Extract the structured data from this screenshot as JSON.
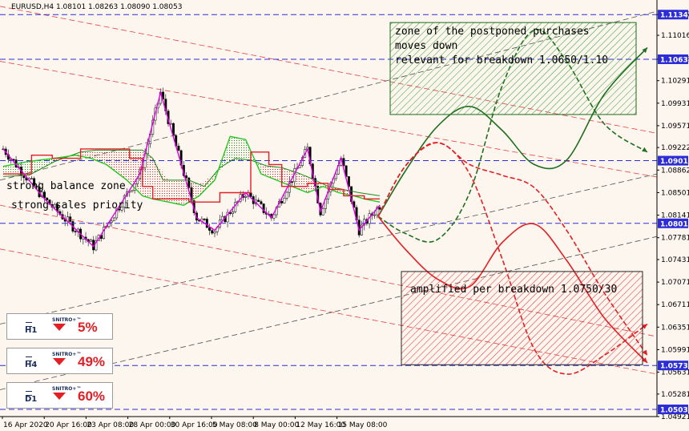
{
  "window_title": "EURUSD,H4  1.08101 1.08263 1.08090 1.08053",
  "chart_data": {
    "type": "line",
    "title": "EURUSD,H4  1.08101 1.08263 1.08090 1.08053",
    "xlabel": "",
    "ylabel": "",
    "ylim": [
      1.04921,
      1.11478
    ],
    "grid": false,
    "y_ticks": [
      "1.11347",
      "1.11016",
      "1.10633",
      "1.10291",
      "1.09931",
      "1.09571",
      "1.09222",
      "1.08862",
      "1.08501",
      "1.08141",
      "1.07781",
      "1.07431",
      "1.07071",
      "1.06711",
      "1.06351",
      "1.05991",
      "1.05631",
      "1.05281",
      "1.04921"
    ],
    "x_ticks": [
      "16 Apr 2020",
      "20 Apr 16:00",
      "23 Apr 08:00",
      "28 Apr 00:00",
      "30 Apr 16:00",
      "5 May 08:00",
      "8 May 00:00",
      "12 May 16:00",
      "15 May 08:00"
    ],
    "levels": [
      {
        "value": 1.11347,
        "label": "1.11347"
      },
      {
        "value": 1.10633,
        "label": "1.10633"
      },
      {
        "value": 1.09012,
        "label": "1.09012"
      },
      {
        "value": 1.0801,
        "label": "1.08010"
      },
      {
        "value": 1.05738,
        "label": "1.05738"
      },
      {
        "value": 1.05036,
        "label": "1.05036"
      }
    ],
    "zigzag": [
      [
        0,
        1.092
      ],
      [
        16,
        1.084
      ],
      [
        35,
        1.0764
      ],
      [
        53,
        1.088
      ],
      [
        61,
        1.101
      ],
      [
        75,
        1.081
      ],
      [
        82,
        1.079
      ],
      [
        94,
        1.085
      ],
      [
        104,
        1.081
      ],
      [
        118,
        1.092
      ],
      [
        123,
        1.082
      ],
      [
        131,
        1.0905
      ],
      [
        138,
        1.079
      ],
      [
        146,
        1.083
      ]
    ],
    "kijun": [
      [
        0,
        1.088
      ],
      [
        11,
        1.088
      ],
      [
        11,
        1.091
      ],
      [
        19,
        1.091
      ],
      [
        19,
        1.0905
      ],
      [
        30,
        1.0905
      ],
      [
        30,
        1.092
      ],
      [
        49,
        1.092
      ],
      [
        49,
        1.0905
      ],
      [
        54,
        1.0905
      ],
      [
        54,
        1.086
      ],
      [
        58,
        1.086
      ],
      [
        58,
        1.084
      ],
      [
        72,
        1.084
      ],
      [
        72,
        1.0835
      ],
      [
        84,
        1.0835
      ],
      [
        84,
        1.085
      ],
      [
        96,
        1.085
      ],
      [
        96,
        1.0915
      ],
      [
        103,
        1.0915
      ],
      [
        103,
        1.0895
      ],
      [
        108,
        1.0895
      ],
      [
        108,
        1.086
      ],
      [
        118,
        1.086
      ],
      [
        118,
        1.0865
      ],
      [
        126,
        1.0865
      ],
      [
        126,
        1.0855
      ],
      [
        132,
        1.0855
      ],
      [
        132,
        1.0845
      ],
      [
        140,
        1.0845
      ],
      [
        140,
        1.084
      ],
      [
        146,
        1.084
      ]
    ],
    "senkou_a": [
      [
        0,
        1.0892
      ],
      [
        10,
        1.09
      ],
      [
        20,
        1.0905
      ],
      [
        28,
        1.091
      ],
      [
        34,
        1.0905
      ],
      [
        40,
        1.0895
      ],
      [
        48,
        1.087
      ],
      [
        54,
        1.0845
      ],
      [
        58,
        1.084
      ],
      [
        64,
        1.0835
      ],
      [
        70,
        1.083
      ],
      [
        76,
        1.0845
      ],
      [
        82,
        1.087
      ],
      [
        88,
        1.094
      ],
      [
        94,
        1.0935
      ],
      [
        100,
        1.088
      ],
      [
        106,
        1.087
      ],
      [
        112,
        1.086
      ],
      [
        118,
        1.085
      ],
      [
        124,
        1.086
      ],
      [
        130,
        1.085
      ],
      [
        136,
        1.0845
      ],
      [
        140,
        1.084
      ],
      [
        146,
        1.0835
      ]
    ],
    "senkou_b": [
      [
        0,
        1.0876
      ],
      [
        10,
        1.0878
      ],
      [
        20,
        1.09
      ],
      [
        30,
        1.0915
      ],
      [
        36,
        1.0918
      ],
      [
        48,
        1.0918
      ],
      [
        54,
        1.0918
      ],
      [
        58,
        1.0905
      ],
      [
        62,
        1.087
      ],
      [
        72,
        1.087
      ],
      [
        78,
        1.086
      ],
      [
        84,
        1.089
      ],
      [
        90,
        1.0905
      ],
      [
        96,
        1.0902
      ],
      [
        102,
        1.0893
      ],
      [
        108,
        1.089
      ],
      [
        114,
        1.0882
      ],
      [
        120,
        1.0872
      ],
      [
        126,
        1.086
      ],
      [
        132,
        1.0855
      ],
      [
        138,
        1.085
      ],
      [
        146,
        1.0845
      ]
    ],
    "forecast_lines": [
      {
        "color": "#1f6f1f",
        "dash": false,
        "points": [
          [
            1.0812,
            0
          ],
          [
            1.0884,
            0.1
          ],
          [
            1.0956,
            0.22
          ],
          [
            1.0988,
            0.34
          ],
          [
            1.095,
            0.46
          ],
          [
            1.0895,
            0.58
          ],
          [
            1.0902,
            0.7
          ],
          [
            1.1007,
            0.84
          ],
          [
            1.1082,
            1.0
          ]
        ]
      },
      {
        "color": "#1f6f1f",
        "dash": true,
        "points": [
          [
            1.0812,
            0
          ],
          [
            1.0785,
            0.1
          ],
          [
            1.0775,
            0.22
          ],
          [
            1.085,
            0.34
          ],
          [
            1.102,
            0.46
          ],
          [
            1.111,
            0.58
          ],
          [
            1.106,
            0.7
          ],
          [
            1.096,
            0.84
          ],
          [
            1.0915,
            1.0
          ]
        ]
      },
      {
        "color": "#e31e24",
        "dash": false,
        "points": [
          [
            1.0812,
            0
          ],
          [
            1.076,
            0.1
          ],
          [
            1.0712,
            0.22
          ],
          [
            1.07,
            0.34
          ],
          [
            1.077,
            0.46
          ],
          [
            1.08,
            0.58
          ],
          [
            1.0742,
            0.7
          ],
          [
            1.065,
            0.84
          ],
          [
            1.0578,
            1.0
          ]
        ]
      },
      {
        "color": "#e31e24",
        "dash": true,
        "points": [
          [
            1.0812,
            0
          ],
          [
            1.0892,
            0.1
          ],
          [
            1.093,
            0.22
          ],
          [
            1.088,
            0.34
          ],
          [
            1.0745,
            0.46
          ],
          [
            1.06,
            0.58
          ],
          [
            1.056,
            0.7
          ],
          [
            1.059,
            0.84
          ],
          [
            1.064,
            1.0
          ]
        ]
      },
      {
        "color": "#e31e24",
        "dash": true,
        "points": [
          [
            1.0812,
            0
          ],
          [
            1.0892,
            0.1
          ],
          [
            1.093,
            0.22
          ],
          [
            1.0895,
            0.34
          ],
          [
            1.0878,
            0.46
          ],
          [
            1.0858,
            0.58
          ],
          [
            1.079,
            0.7
          ],
          [
            1.069,
            0.84
          ],
          [
            1.059,
            1.0
          ]
        ]
      }
    ],
    "zones": [
      {
        "name": "zone of the postponed purchases",
        "color": "#2a9a2a",
        "y_top": 1.1122,
        "y_bottom": 1.0975
      },
      {
        "name": "amplified per breakdown",
        "color": "#e31e24",
        "y_top": 1.0724,
        "y_bottom": 1.0575
      }
    ]
  },
  "annotations": {
    "left_1": "strong balance zone",
    "left_2": "strong sales priority",
    "green_zone_1": "zone of the postponed purchases",
    "green_zone_2": "moves down",
    "green_zone_3": "relevant for breakdown 1.0650/1.10",
    "red_zone": "amplified per breakdown 1.0750/30"
  },
  "widgets": [
    {
      "timeframe": "H1",
      "brand": "SNITRO+™",
      "value": "5%",
      "color": "#e31e24"
    },
    {
      "timeframe": "H4",
      "brand": "SNITRO+™",
      "value": "49%",
      "color": "#e31e24"
    },
    {
      "timeframe": "D1",
      "brand": "SNITRO+™",
      "value": "60%",
      "color": "#e31e24"
    }
  ],
  "colors": {
    "zigzag": "#e000e0",
    "kijun": "#e31e24",
    "senkou_a": "#22c722",
    "senkou_b": "#1a8a1a",
    "level": "#2d2dd8",
    "candle": "#444444",
    "channel_red": "#e31e24",
    "channel_black": "#333333"
  }
}
